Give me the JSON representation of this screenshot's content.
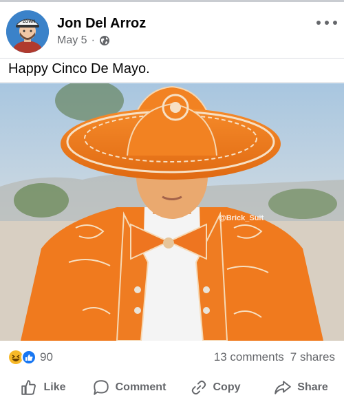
{
  "post": {
    "author": "Jon Del Arroz",
    "date": "May 5",
    "separator": "·",
    "caption": "Happy Cinco De Mayo.",
    "watermark": "@Brick_Suit",
    "avatar_cap_text": "ZOWN"
  },
  "engagement": {
    "reaction_count": "90",
    "comments": "13 comments",
    "shares": "7 shares"
  },
  "actions": {
    "like": "Like",
    "comment": "Comment",
    "copy": "Copy",
    "share": "Share"
  },
  "icons": {
    "privacy": "globe-icon",
    "more": "more-options-icon",
    "reactions": [
      "haha-reaction-icon",
      "like-reaction-icon"
    ],
    "like": "thumbs-up-icon",
    "comment": "speech-bubble-icon",
    "copy": "link-icon",
    "share": "share-arrow-icon"
  },
  "colors": {
    "accent": "#1877f2",
    "secondary_text": "#65676b",
    "suit_orange": "#f07a1e",
    "haha_yellow": "#f7b928"
  }
}
